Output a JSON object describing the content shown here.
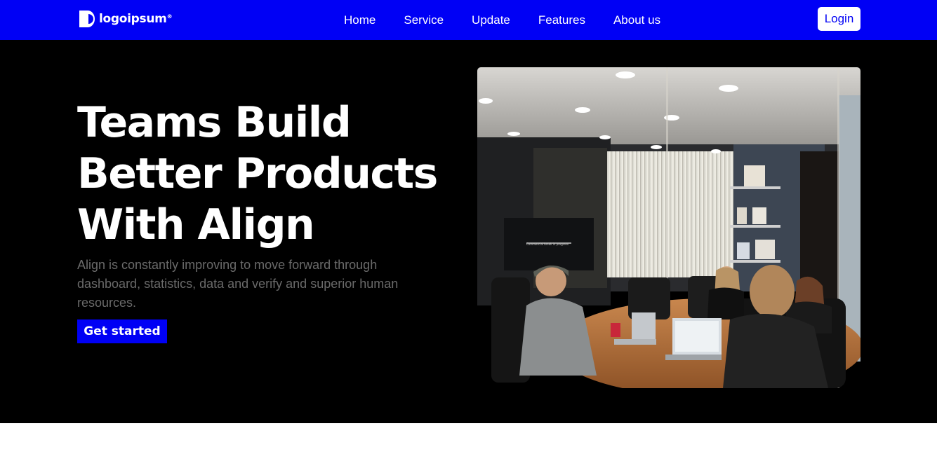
{
  "brand": {
    "logo_text": "logoipsum",
    "logo_mark": "®",
    "accent_color": "#0000f5"
  },
  "nav": {
    "items": [
      {
        "label": "Home"
      },
      {
        "label": "Service"
      },
      {
        "label": "Update"
      },
      {
        "label": "Features"
      },
      {
        "label": "About us"
      }
    ],
    "login_label": "Login"
  },
  "hero": {
    "title_lines": [
      "Teams Build",
      "Better Products",
      "With Align"
    ],
    "subtitle": "Align is constantly improving to move forward through dashboard, statistics, data and verify and superior human resources.",
    "cta_label": "Get started",
    "image_alt": "team meeting in a conference room",
    "tv_caption": "Commercial break in progress."
  },
  "icons": {
    "logo_icon": "logo-icon"
  }
}
